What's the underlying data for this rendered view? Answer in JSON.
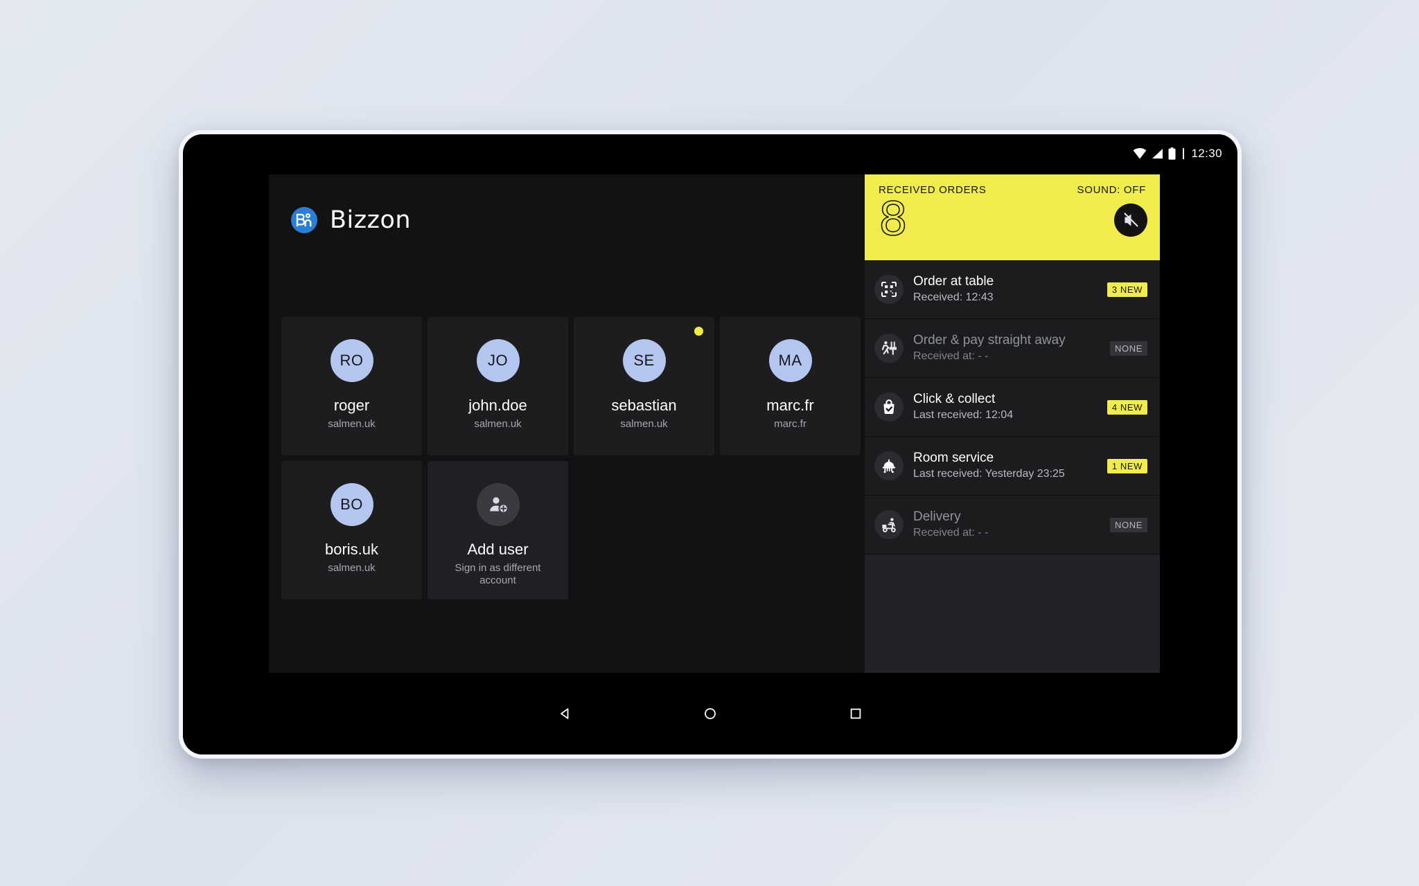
{
  "status_bar": {
    "time": "12:30",
    "icons": [
      "wifi-icon",
      "signal-icon",
      "battery-icon"
    ]
  },
  "brand": {
    "name": "Bizzon",
    "logo_letter": "B",
    "logo_color": "#2a7fd4"
  },
  "accounts": {
    "cards": [
      {
        "initials": "RO",
        "name": "roger",
        "sub": "salmen.uk",
        "dot": false,
        "type": "user"
      },
      {
        "initials": "JO",
        "name": "john.doe",
        "sub": "salmen.uk",
        "dot": false,
        "type": "user"
      },
      {
        "initials": "SE",
        "name": "sebastian",
        "sub": "salmen.uk",
        "dot": true,
        "type": "user"
      },
      {
        "initials": "MA",
        "name": "marc.fr",
        "sub": "marc.fr",
        "dot": false,
        "type": "user"
      },
      {
        "initials": "BO",
        "name": "boris.uk",
        "sub": "salmen.uk",
        "dot": false,
        "type": "user"
      },
      {
        "initials": "",
        "name": "Add user",
        "sub": "Sign in as different account",
        "dot": false,
        "type": "add"
      }
    ]
  },
  "orders": {
    "header_label": "RECEIVED ORDERS",
    "sound_label": "SOUND: OFF",
    "count": "8",
    "mute_icon": "mute-icon",
    "header_color": "#f1ec4e",
    "rows": [
      {
        "icon": "qr-scan-icon",
        "title": "Order at table",
        "sub": "Received: 12:43",
        "badge": "3 NEW",
        "badge_type": "new",
        "active": true
      },
      {
        "icon": "table-service-icon",
        "title": "Order & pay straight away",
        "sub": "Received at: - -",
        "badge": "NONE",
        "badge_type": "none",
        "active": false
      },
      {
        "icon": "shopping-bag-check-icon",
        "title": "Click & collect",
        "sub": "Last received: 12:04",
        "badge": "4 NEW",
        "badge_type": "new",
        "active": true
      },
      {
        "icon": "room-service-trolley-icon",
        "title": "Room service",
        "sub": "Last received: Yesterday 23:25",
        "badge": "1 NEW",
        "badge_type": "new",
        "active": true
      },
      {
        "icon": "delivery-scooter-icon",
        "title": "Delivery",
        "sub": "Received at: - -",
        "badge": "NONE",
        "badge_type": "none",
        "active": false
      }
    ]
  },
  "nav_bar": {
    "back": "back-icon",
    "home": "home-icon",
    "recents": "recents-icon"
  }
}
